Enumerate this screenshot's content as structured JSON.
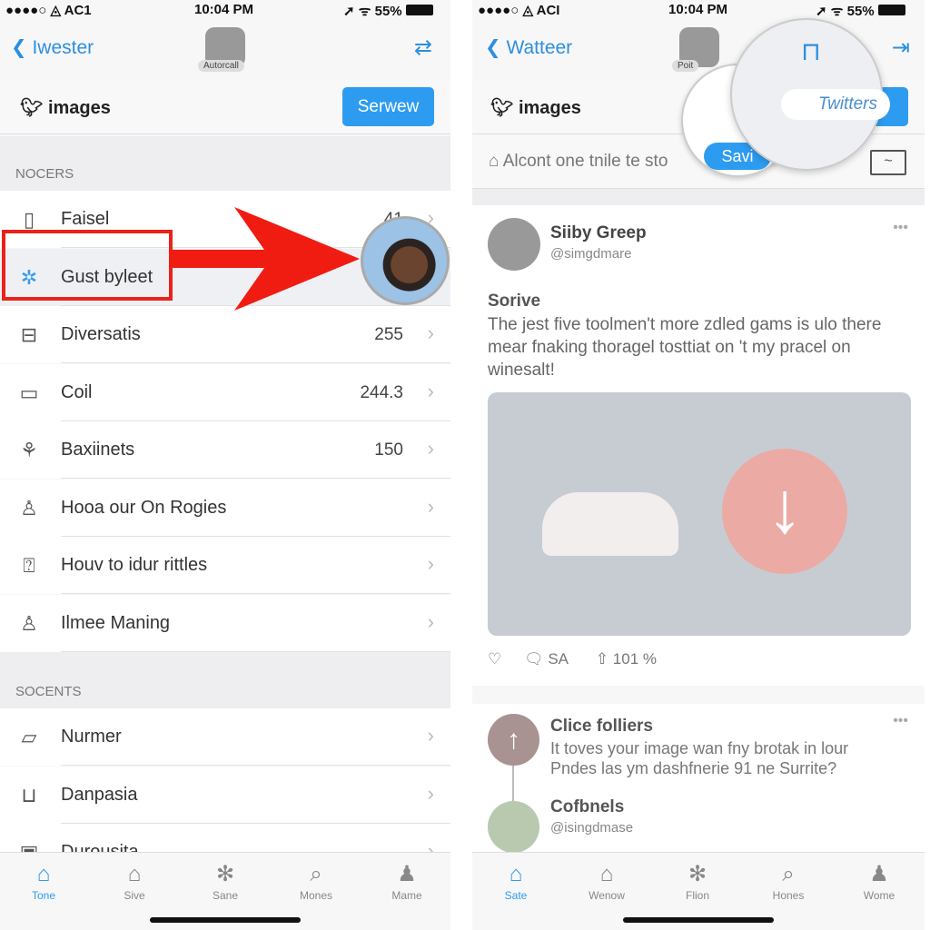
{
  "left": {
    "status": {
      "carrier": "●●●●○ ◬ AC1",
      "time": "10:04 PM",
      "battery": "55%"
    },
    "nav": {
      "back": "Iwester",
      "center_label": "Autorcall"
    },
    "title": "images",
    "action_button": "Serwew",
    "sections": [
      {
        "header": "NOCERS",
        "items": [
          {
            "label": "Faisel",
            "value": "41",
            "icon": "sim-card-icon"
          },
          {
            "label": "Gust byleet",
            "value": "",
            "icon": "sparkle-icon",
            "highlighted": true
          },
          {
            "label": "Diversatis",
            "value": "255",
            "icon": "inbox-icon"
          },
          {
            "label": "Coil",
            "value": "244.3",
            "icon": "folder-icon"
          },
          {
            "label": "Baxiinets",
            "value": "150",
            "icon": "plant-icon"
          },
          {
            "label": "Hooa our On Rogies",
            "value": "",
            "icon": "person-icon"
          },
          {
            "label": "Houv to idur rittles",
            "value": "",
            "icon": "alert-bubble-icon"
          },
          {
            "label": "Ilmee Maning",
            "value": "",
            "icon": "person-icon"
          }
        ]
      },
      {
        "header": "SOCENTS",
        "items": [
          {
            "label": "Nurmer",
            "value": "",
            "icon": "chat-bubble-icon"
          },
          {
            "label": "Danpasia",
            "value": "",
            "icon": "tray-icon"
          },
          {
            "label": "Durousita",
            "value": "",
            "icon": "box-icon"
          }
        ]
      }
    ],
    "tabs": [
      {
        "label": "Tone",
        "active": true
      },
      {
        "label": "Sive"
      },
      {
        "label": "Sane"
      },
      {
        "label": "Mones"
      },
      {
        "label": "Mame"
      }
    ]
  },
  "right": {
    "status": {
      "carrier": "●●●●○ ◬ ACI",
      "time": "10:04 PM",
      "battery": "55%"
    },
    "nav": {
      "back": "Watteer",
      "center_label": "Poit"
    },
    "title": "images",
    "magnifier_button": "Twitters",
    "save_pill": "Savi",
    "search_placeholder": "Alcont one tnile te sto",
    "post": {
      "name": "Siiby Greep",
      "handle": "@simgdmare",
      "heading": "Sorive",
      "body": "The jest five toolmen't more zdled gams is ulo there mear fnaking thoragel tosttiat on 't my pracel on winesalt!",
      "comments": "SA",
      "share": "101 %"
    },
    "post2": {
      "name": "Clice folliers",
      "body": "It toves your image wan fny brotak in lour Pndes las ym dashfnerie 91 ne Surrite?"
    },
    "post3": {
      "name": "Cofbnels",
      "handle": "@isingdmase"
    },
    "tabs": [
      {
        "label": "Sate",
        "active": true
      },
      {
        "label": "Wenow"
      },
      {
        "label": "Flion"
      },
      {
        "label": "Hones"
      },
      {
        "label": "Wome"
      }
    ]
  },
  "colors": {
    "accent": "#2d9cf0",
    "annotation": "#e8231a"
  }
}
